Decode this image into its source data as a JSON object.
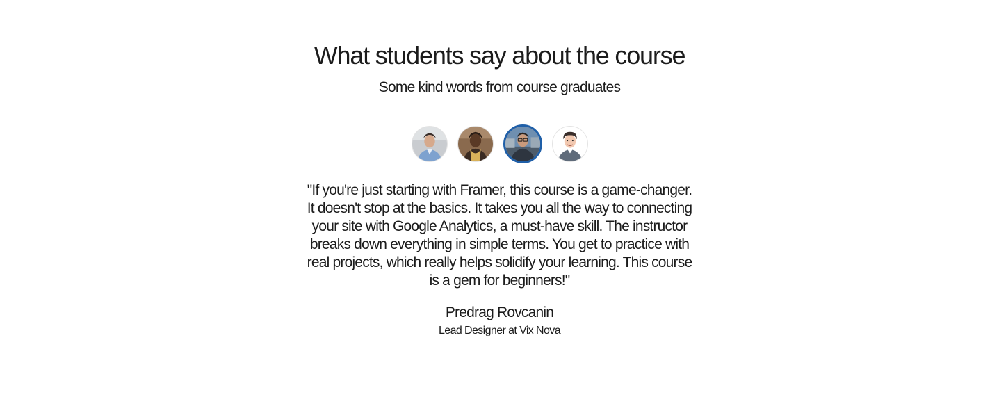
{
  "testimonials": {
    "heading": "What students say about the course",
    "subheading": "Some kind words from course graduates",
    "avatars": [
      {
        "icon": "person-avatar-icon",
        "active": false
      },
      {
        "icon": "person-avatar-icon",
        "active": false
      },
      {
        "icon": "person-avatar-icon",
        "active": true
      },
      {
        "icon": "illustrated-avatar-icon",
        "active": false
      }
    ],
    "quote": "\"If you're just starting with Framer, this course is a game-changer. It doesn't stop at the basics. It takes you all the way to connecting your site with Google Analytics, a must-have skill. The instructor breaks down everything in simple terms. You get to practice with real projects, which really helps solidify your learning. This course is a gem for beginners!\"",
    "author_name": "Predrag Rovcanin",
    "author_role": "Lead Designer at Vix Nova",
    "colors": {
      "text": "#1c1c1c",
      "active_ring": "#1f5fa8",
      "active_ring_inner": "#d95a2b",
      "background": "#ffffff"
    }
  }
}
